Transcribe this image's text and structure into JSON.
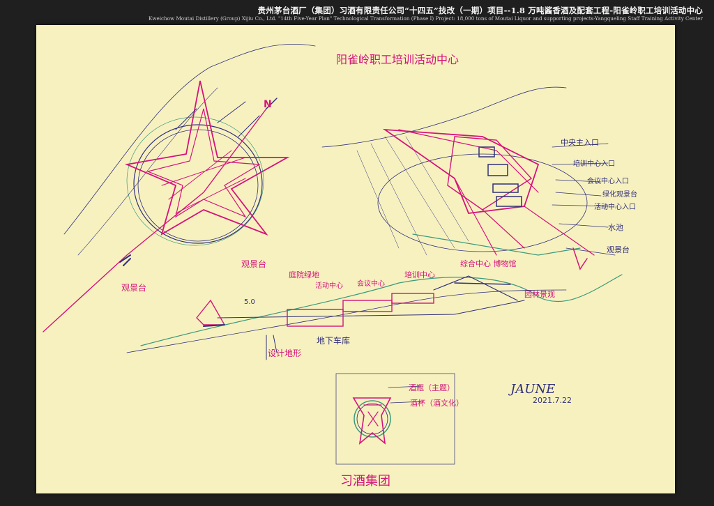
{
  "header": {
    "title_cn": "贵州茅台酒厂（集团）习酒有限责任公司“十四五”技改（一期）项目--1.8 万吨酱香酒及配套工程-阳雀岭职工培训活动中心",
    "title_en": "Kweichow Moutai Distillery (Group) Xijiu Co., Ltd. \"14th Five-Year Plan\" Technological Transformation (Phase I) Project: 18,000 tons of Moutai Liquor and supporting projects-Yangqueling Staff Training Activity Center"
  },
  "sketch": {
    "main_title": "阳雀岭职工培训活动中心",
    "north_mark": "N",
    "plan_labels": {
      "main_entrance": "中央主入口",
      "training_center": "培训中心入口",
      "admin_entrance": "会议中心入口",
      "terrace": "绿化观景台",
      "activity_entrance": "活动中心入口",
      "pool": "水池",
      "viewing_platform": "观景台"
    },
    "section_labels": {
      "viewpoint": "观景台",
      "courtyard": "庭院绿地",
      "entrance_top": "活动中心",
      "water": "会议中心",
      "center": "培训中心",
      "museum": "综合中心 博物馆",
      "scenery": "园林景观",
      "road": "5.0",
      "parking": "地下车库",
      "slope": "设计地形"
    },
    "logo_labels": {
      "line1": "酒瓶（主题）",
      "line2": "酒杯（酒文化）"
    },
    "logo_caption": "习酒集团",
    "signature": "JAUNE",
    "date": "2021.7.22"
  },
  "colors": {
    "paper": "#f7f1c0",
    "magenta": "#d4147a",
    "ink": "#30307a",
    "green": "#3a9a7a",
    "background": "#1f1f1f"
  }
}
